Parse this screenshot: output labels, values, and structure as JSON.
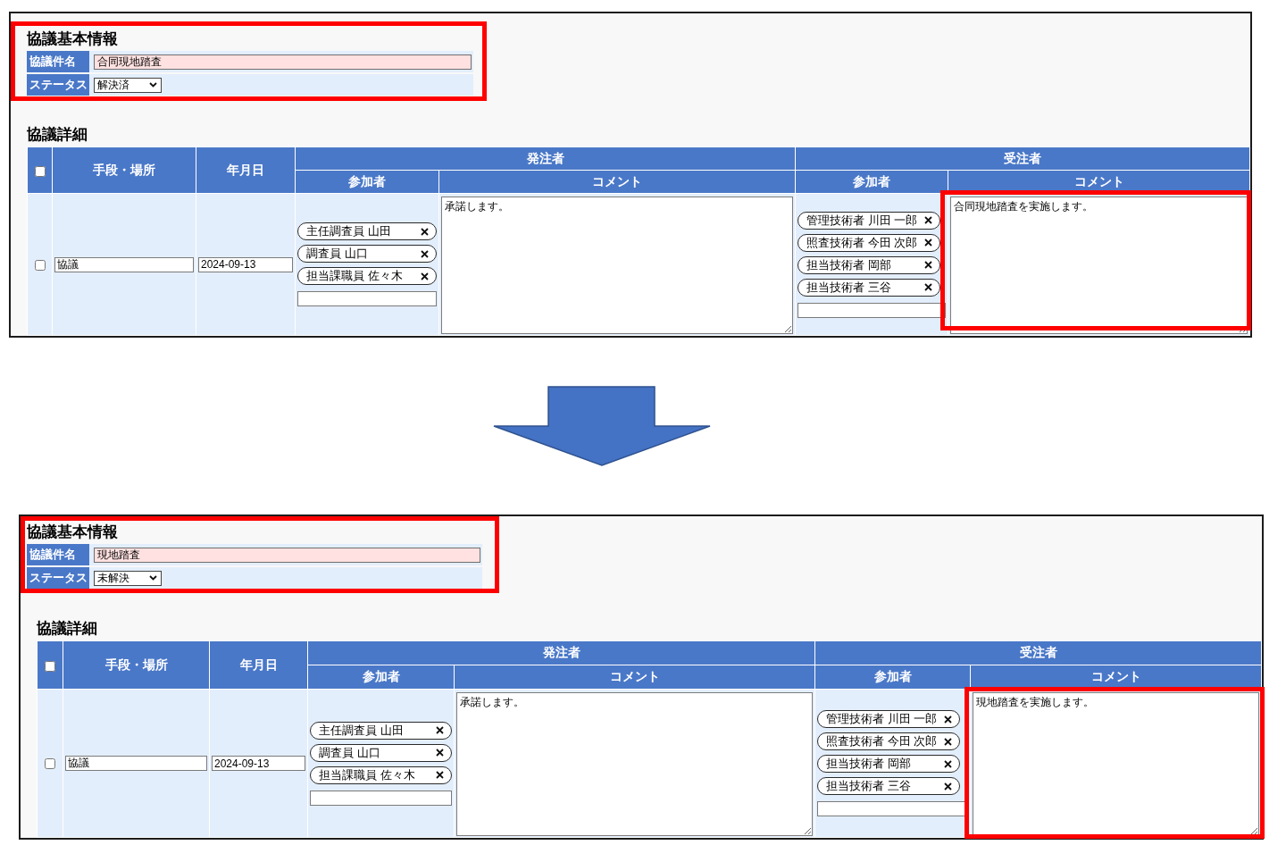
{
  "screens": [
    {
      "basic_info": {
        "heading": "協議基本情報",
        "highlighted": true,
        "fields": [
          {
            "kind": "text",
            "label": "協議件名",
            "value": "合同現地踏査"
          },
          {
            "kind": "select",
            "label": "ステータス",
            "value": "解決済"
          }
        ]
      },
      "details": {
        "heading": "協議詳細",
        "select_all": {
          "checked": false
        },
        "columns": [
          "手段・場所",
          "年月日"
        ],
        "groups": [
          {
            "label": "発注者",
            "columns": [
              "参加者",
              "コメント"
            ]
          },
          {
            "label": "受注者",
            "columns": [
              "参加者",
              "コメント"
            ]
          }
        ],
        "rows": [
          {
            "checked": false,
            "method": "協議",
            "date": "2024-09-13",
            "parties": [
              {
                "participants": [
                  "主任調査員 山田",
                  "調査員 山口",
                  "担当課職員 佐々木"
                ],
                "comment": "承諾します。",
                "comment_highlighted": false
              },
              {
                "participants": [
                  "管理技術者 川田 一郎",
                  "照査技術者 今田 次郎",
                  "担当技術者 岡部",
                  "担当技術者 三谷"
                ],
                "comment": "合同現地踏査を実施します。",
                "comment_highlighted": true
              }
            ]
          }
        ]
      }
    },
    {
      "basic_info": {
        "heading": "協議基本情報",
        "highlighted": true,
        "fields": [
          {
            "kind": "text",
            "label": "協議件名",
            "value": "現地踏査"
          },
          {
            "kind": "select",
            "label": "ステータス",
            "value": "未解決"
          }
        ]
      },
      "details": {
        "heading": "協議詳細",
        "select_all": {
          "checked": false
        },
        "columns": [
          "手段・場所",
          "年月日"
        ],
        "groups": [
          {
            "label": "発注者",
            "columns": [
              "参加者",
              "コメント"
            ]
          },
          {
            "label": "受注者",
            "columns": [
              "参加者",
              "コメント"
            ]
          }
        ],
        "rows": [
          {
            "checked": false,
            "method": "協議",
            "date": "2024-09-13",
            "parties": [
              {
                "participants": [
                  "主任調査員 山田",
                  "調査員 山口",
                  "担当課職員 佐々木"
                ],
                "comment": "承諾します。",
                "comment_highlighted": false
              },
              {
                "participants": [
                  "管理技術者 川田 一郎",
                  "照査技術者 今田 次郎",
                  "担当技術者 岡部",
                  "担当技術者 三谷"
                ],
                "comment": "現地踏査を実施します。",
                "comment_highlighted": true
              }
            ]
          }
        ]
      }
    }
  ]
}
